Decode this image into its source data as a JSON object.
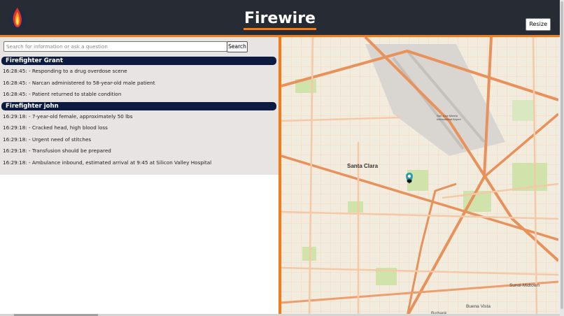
{
  "header": {
    "app_title": "Firewire",
    "resize_label": "Resize"
  },
  "search": {
    "placeholder": "Search for information or ask a question",
    "button_label": "Search"
  },
  "groups": [
    {
      "name": "Firefighter Grant",
      "entries": [
        "16:28:45: - Responding to a drug overdose scene",
        "16:28:45: - Narcan administered to 58-year-old male patient",
        "16:28:45: - Patient returned to stable condition"
      ]
    },
    {
      "name": "Firefighter john",
      "entries": [
        "16:29:18: - 7-year-old female, approximately 50 lbs",
        "16:29:18: - Cracked head, high blood loss",
        "16:29:18: - Urgent need of stitches",
        "16:29:18: - Transfusion should be prepared",
        "16:29:18: - Ambulance inbound, estimated arrival at 9:45 at Silicon Valley Hospital"
      ]
    }
  ],
  "map": {
    "city_label": "Santa Clara",
    "labels": {
      "sunol_midtown": "Sunol-Midtown",
      "buena_vista": "Buena Vista",
      "burbank": "Burbank",
      "airport": "San Jose Mineta International Airport"
    },
    "marker_icon": "map-pin-icon",
    "colors": {
      "major_road": "#e8915a",
      "minor_road": "#f3c9a8",
      "park": "#c9e0a5",
      "airport": "#d2cfcb"
    }
  },
  "colors": {
    "accent": "#f07c1c",
    "header_bg": "#272b33",
    "group_header_bg": "#0c1b3f"
  }
}
